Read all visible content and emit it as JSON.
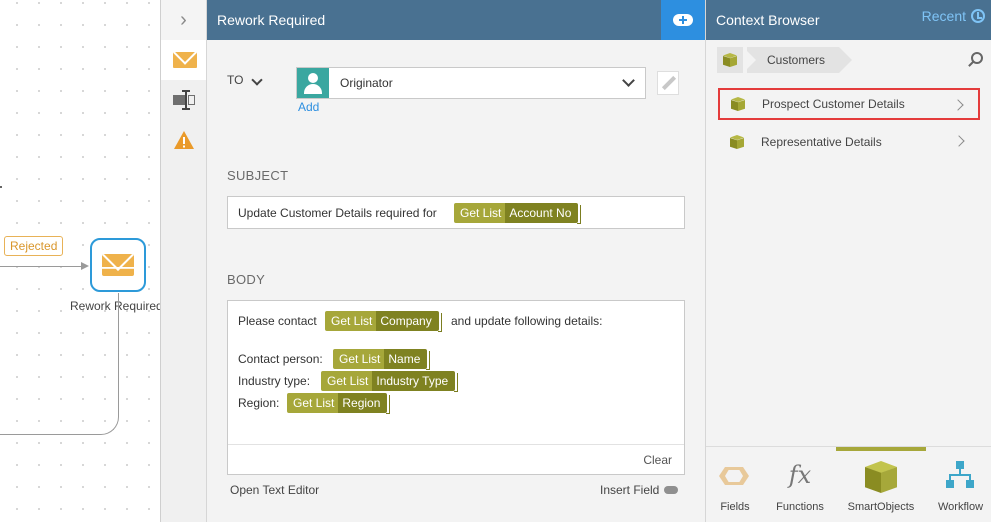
{
  "canvas": {
    "rejected_label": "Rejected",
    "node_label": "Rework Required"
  },
  "rail": {
    "expand_glyph": "›"
  },
  "editor": {
    "title": "Rework Required",
    "to_label": "TO",
    "recipient": "Originator",
    "add_label": "Add",
    "subject_label": "SUBJECT",
    "subject_text": "Update Customer Details required for",
    "subject_token": {
      "source": "Get List",
      "field": "Account No"
    },
    "body_label": "BODY",
    "body": {
      "line1_pre": "Please contact",
      "line1_token": {
        "source": "Get List",
        "field": "Company"
      },
      "line1_post": "and update following details:",
      "contact_label": "Contact person:",
      "contact_token": {
        "source": "Get List",
        "field": "Name"
      },
      "industry_label": "Industry type:",
      "industry_token": {
        "source": "Get List",
        "field": "Industry Type"
      },
      "region_label": "Region:",
      "region_token": {
        "source": "Get List",
        "field": "Region"
      }
    },
    "clear_label": "Clear",
    "open_text_editor": "Open Text Editor",
    "insert_field": "Insert Field"
  },
  "context": {
    "title": "Context Browser",
    "recent_label": "Recent",
    "breadcrumb": "Customers",
    "items": [
      {
        "label": "Prospect Customer Details",
        "highlighted": true
      },
      {
        "label": "Representative Details",
        "highlighted": false
      }
    ],
    "bottom_tabs": [
      {
        "label": "Fields"
      },
      {
        "label": "Functions"
      },
      {
        "label": "SmartObjects",
        "active": true
      },
      {
        "label": "Workflow"
      }
    ],
    "fx_glyph": "fx",
    "accent_color": "#a6a73a",
    "header_color": "#497191",
    "highlight_color": "#e43b3b"
  }
}
